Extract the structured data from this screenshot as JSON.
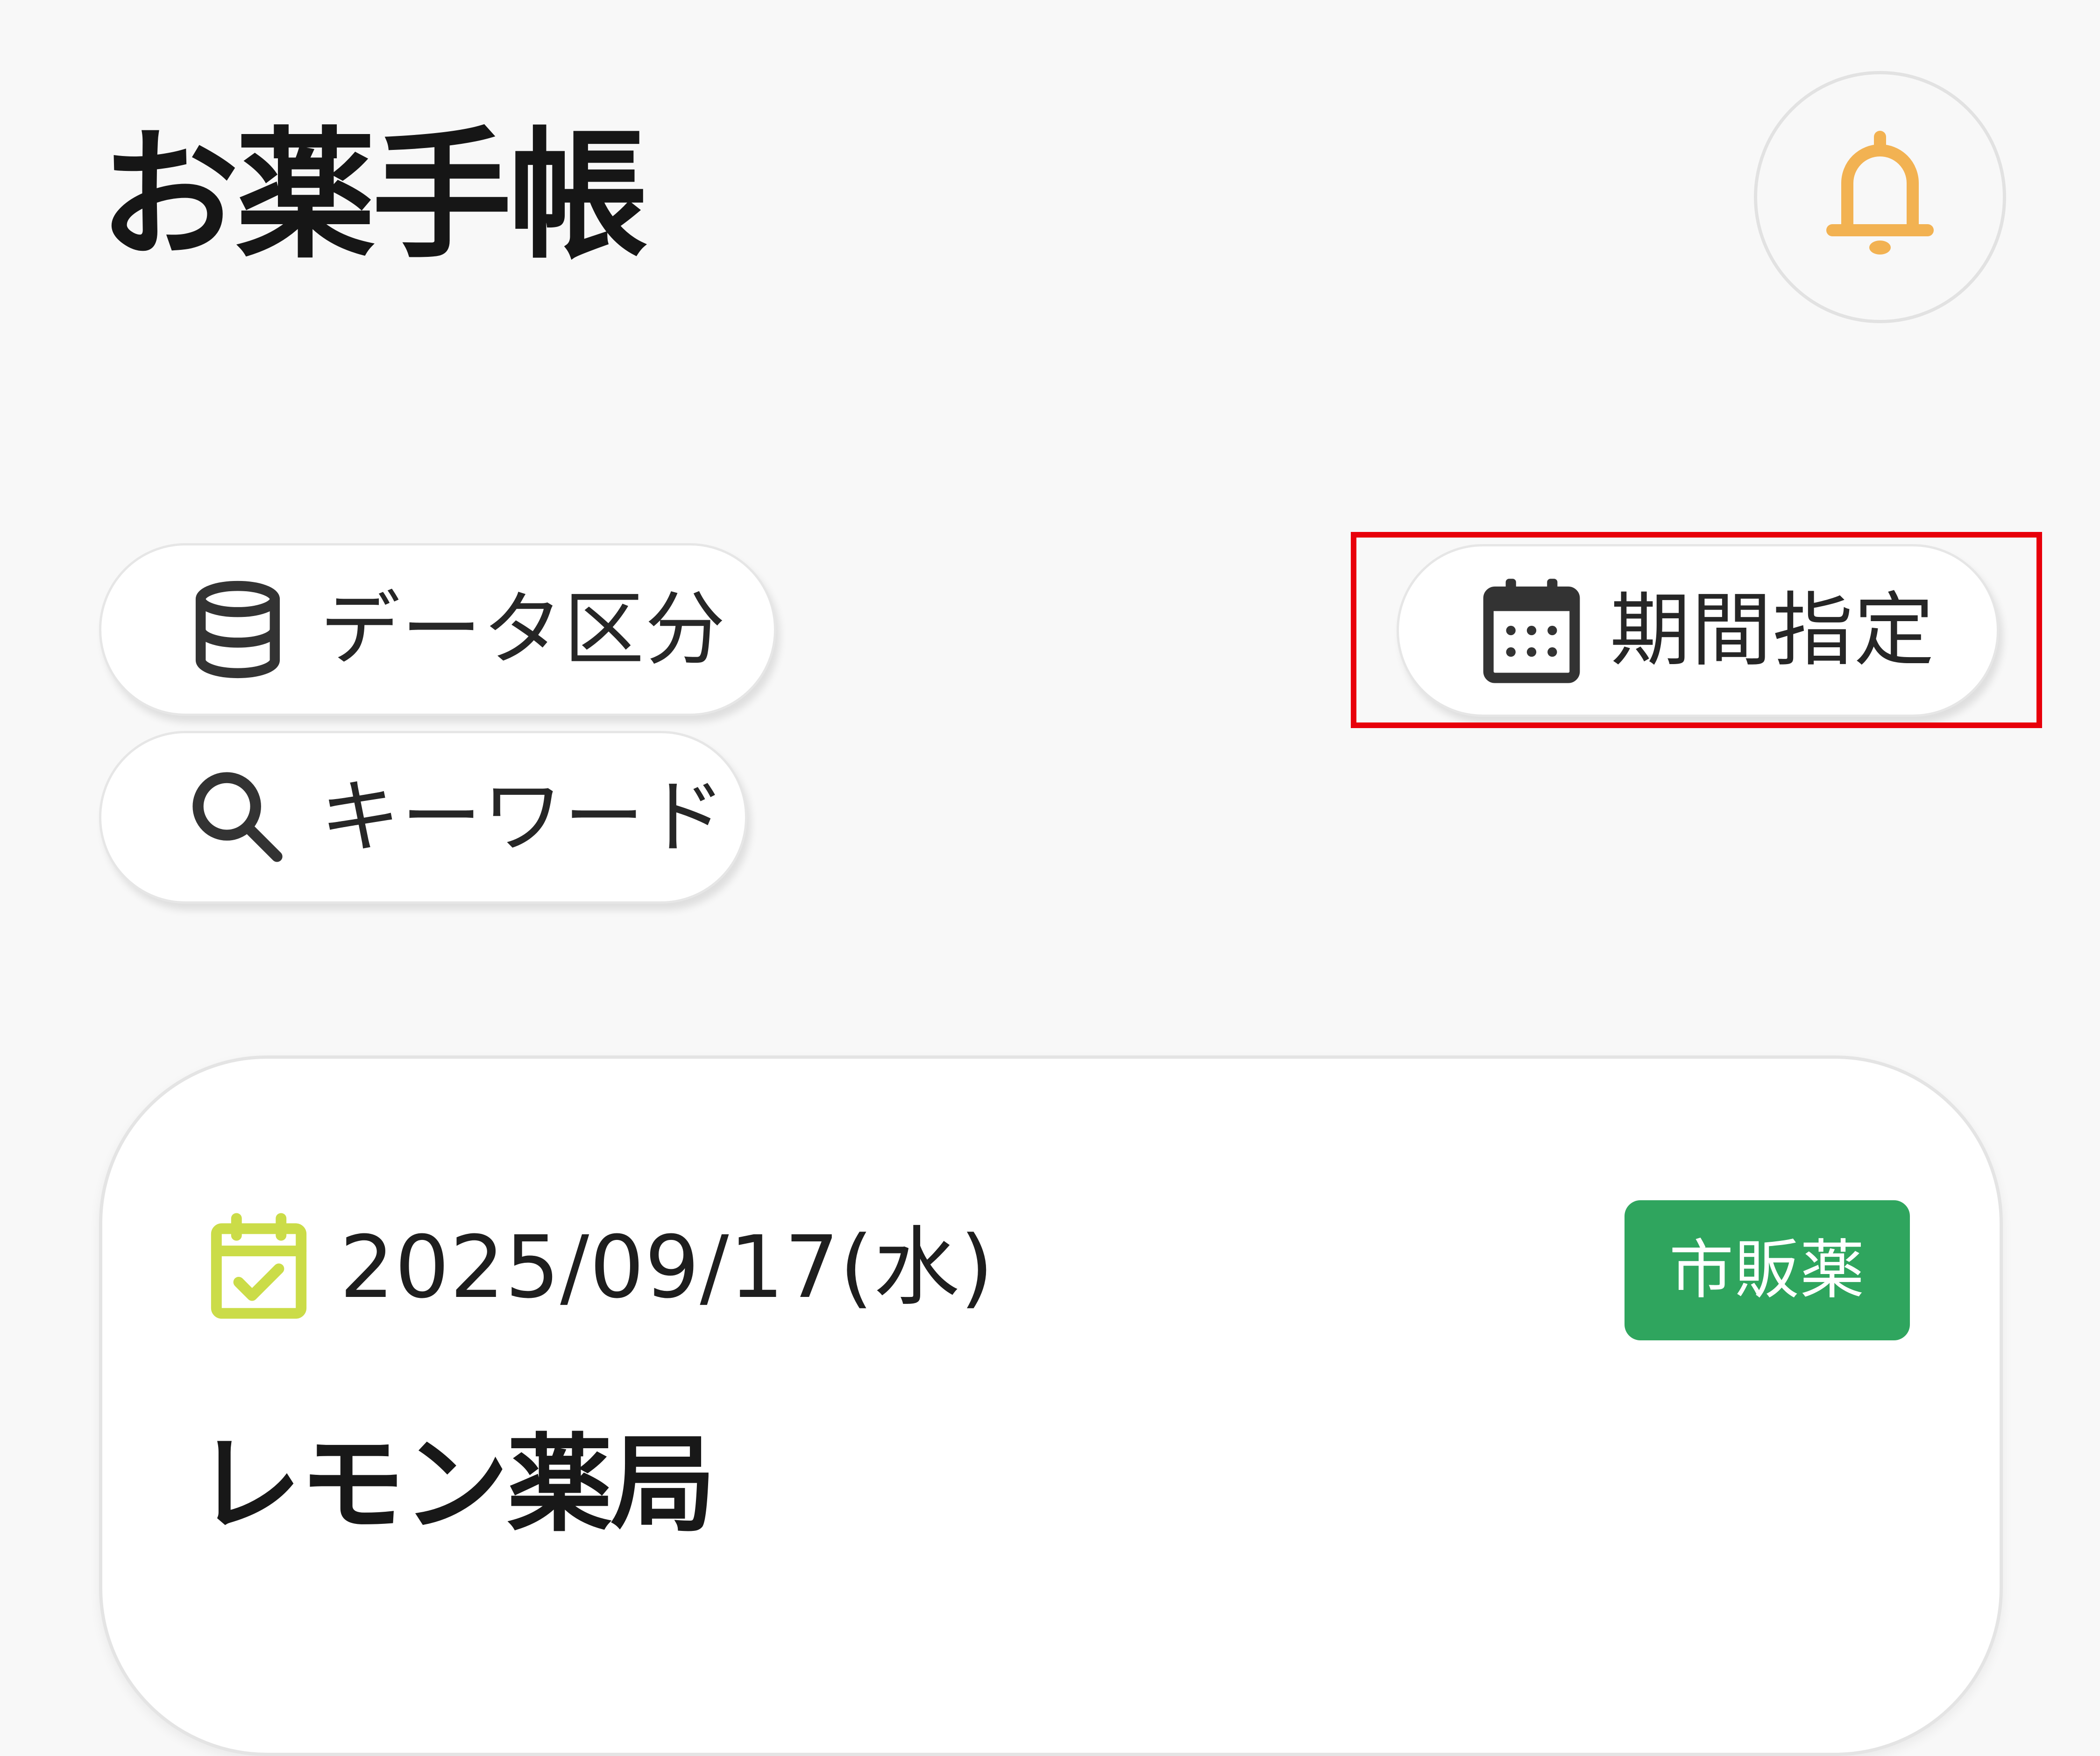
{
  "header": {
    "title": "お薬手帳",
    "notification_icon": "bell-icon"
  },
  "filters": {
    "data_category": {
      "label": "データ区分",
      "icon": "database-icon"
    },
    "keyword": {
      "label": "キーワード",
      "icon": "search-icon"
    },
    "period": {
      "label": "期間指定",
      "icon": "calendar-icon",
      "highlighted": true
    }
  },
  "records": [
    {
      "date": "2025/09/17(水)",
      "date_icon": "calendar-check-icon",
      "category_badge": "市販薬",
      "pharmacy": "レモン薬局"
    }
  ],
  "colors": {
    "background": "#f8f8f8",
    "bell_accent": "#f2b252",
    "date_icon_accent": "#cbdc48",
    "badge_green": "#2fa55e",
    "highlight_red": "#e8000b",
    "icon_dark": "#333333"
  }
}
